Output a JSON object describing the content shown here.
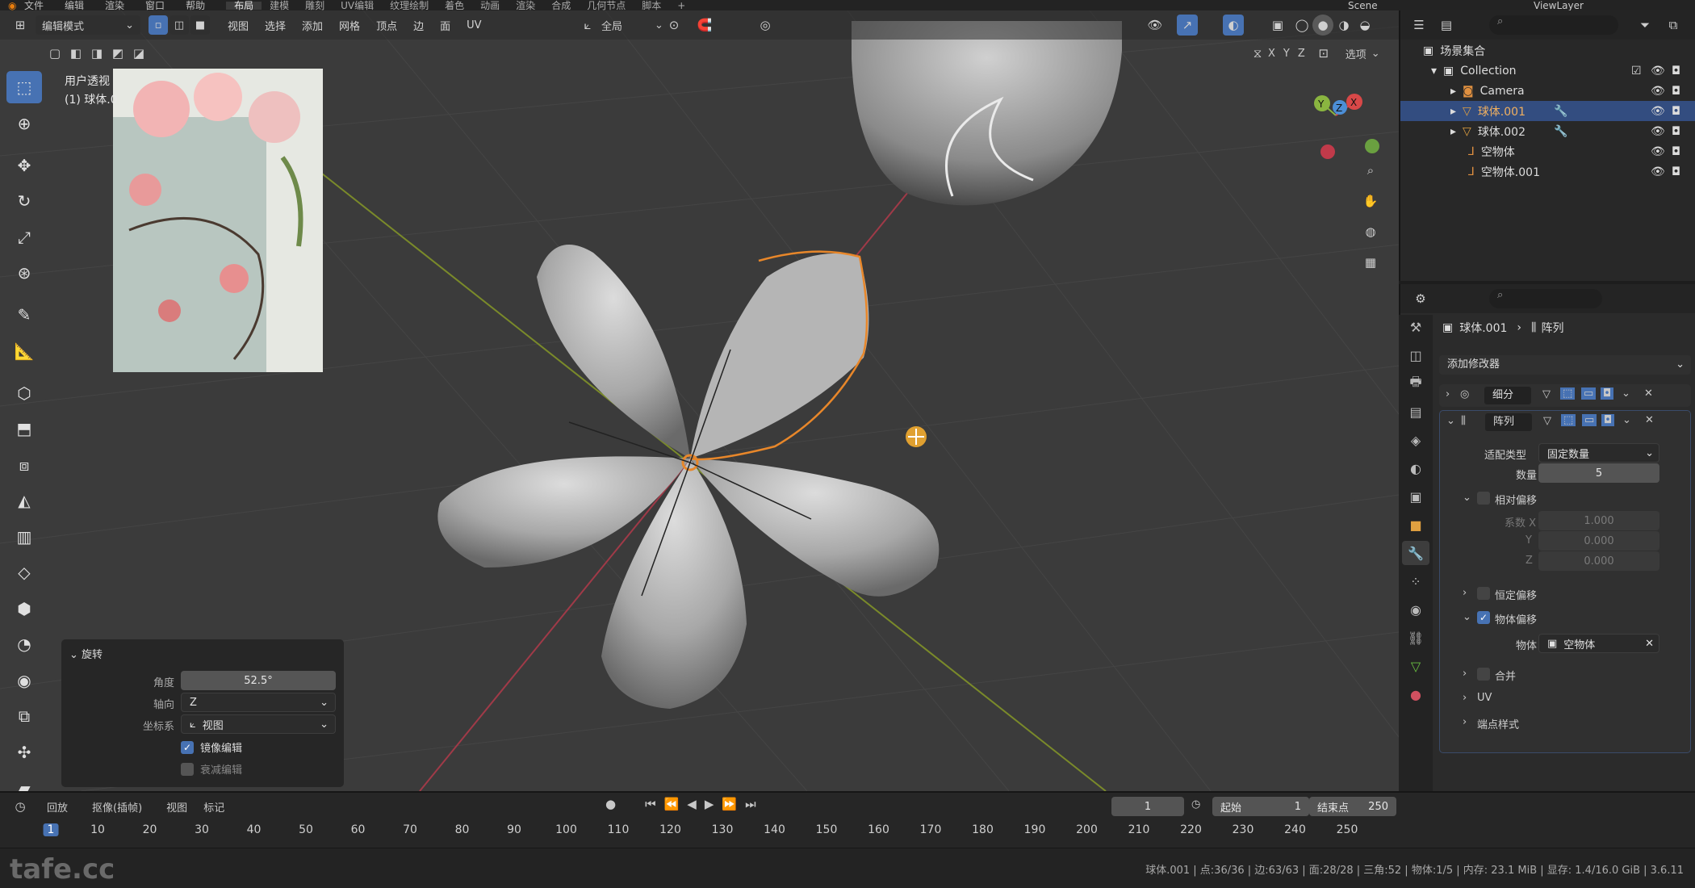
{
  "menu": {
    "items": [
      "文件",
      "编辑",
      "渲染",
      "窗口",
      "帮助"
    ],
    "workspaces": [
      "布局",
      "建模",
      "雕刻",
      "UV编辑",
      "纹理绘制",
      "着色",
      "动画",
      "渲染",
      "合成",
      "几何节点",
      "脚本"
    ],
    "active_workspace": "布局",
    "scene": "Scene",
    "view_layer": "ViewLayer"
  },
  "viewport": {
    "mode": "编辑模式",
    "menus": [
      "视图",
      "选择",
      "添加",
      "网格",
      "顶点",
      "边",
      "面",
      "UV"
    ],
    "transform_orientation": "全局",
    "axes": [
      "X",
      "Y",
      "Z"
    ],
    "options": "选项",
    "overlay_title": "用户透视",
    "overlay_object": "(1) 球体.0",
    "gizmo": {
      "y": "Y",
      "z": "Z",
      "x": "X"
    }
  },
  "operator": {
    "title": "旋转",
    "angle_label": "角度",
    "angle": "52.5°",
    "axis_label": "轴向",
    "axis": "Z",
    "orient_label": "坐标系",
    "orient": "视图",
    "mirror_label": "镜像编辑",
    "mirror": true,
    "proportional_label": "衰减编辑",
    "proportional": false
  },
  "outliner": {
    "root": "场景集合",
    "items": [
      {
        "name": "Collection"
      },
      {
        "name": "Camera"
      },
      {
        "name": "球体.001"
      },
      {
        "name": "球体.002"
      },
      {
        "name": "空物体"
      },
      {
        "name": "空物体.001"
      }
    ]
  },
  "props": {
    "object": "球体.001",
    "modifier_path": "阵列",
    "add_modifier": "添加修改器",
    "mod1": "细分",
    "mod2": "阵列",
    "fit_type_label": "适配类型",
    "fit_type": "固定数量",
    "count_label": "数量",
    "count": "5",
    "relative_offset": "相对偏移",
    "factor_x_label": "系数 X",
    "factor_x": "1.000",
    "y_label": "Y",
    "y": "0.000",
    "z_label": "Z",
    "z": "0.000",
    "constant_offset": "恒定偏移",
    "object_offset": "物体偏移",
    "object_label": "物体",
    "object_value": "空物体",
    "merge": "合并",
    "uv": "UV",
    "caps": "端点样式"
  },
  "timeline": {
    "menus": [
      "回放",
      "抠像(插帧)",
      "视图",
      "标记"
    ],
    "current": "1",
    "start_label": "起始",
    "start": "1",
    "end_label": "结束点",
    "end": "250",
    "frames": [
      "1",
      "10",
      "20",
      "30",
      "40",
      "50",
      "60",
      "70",
      "80",
      "90",
      "100",
      "110",
      "120",
      "130",
      "140",
      "150",
      "160",
      "170",
      "180",
      "190",
      "200",
      "210",
      "220",
      "230",
      "240",
      "250"
    ]
  },
  "status": "球体.001 | 点:36/36 | 边:63/63 | 面:28/28 | 三角:52 | 物体:1/5 | 内存: 23.1 MiB | 显存: 1.4/16.0 GiB | 3.6.11",
  "watermark": "tafe.cc"
}
